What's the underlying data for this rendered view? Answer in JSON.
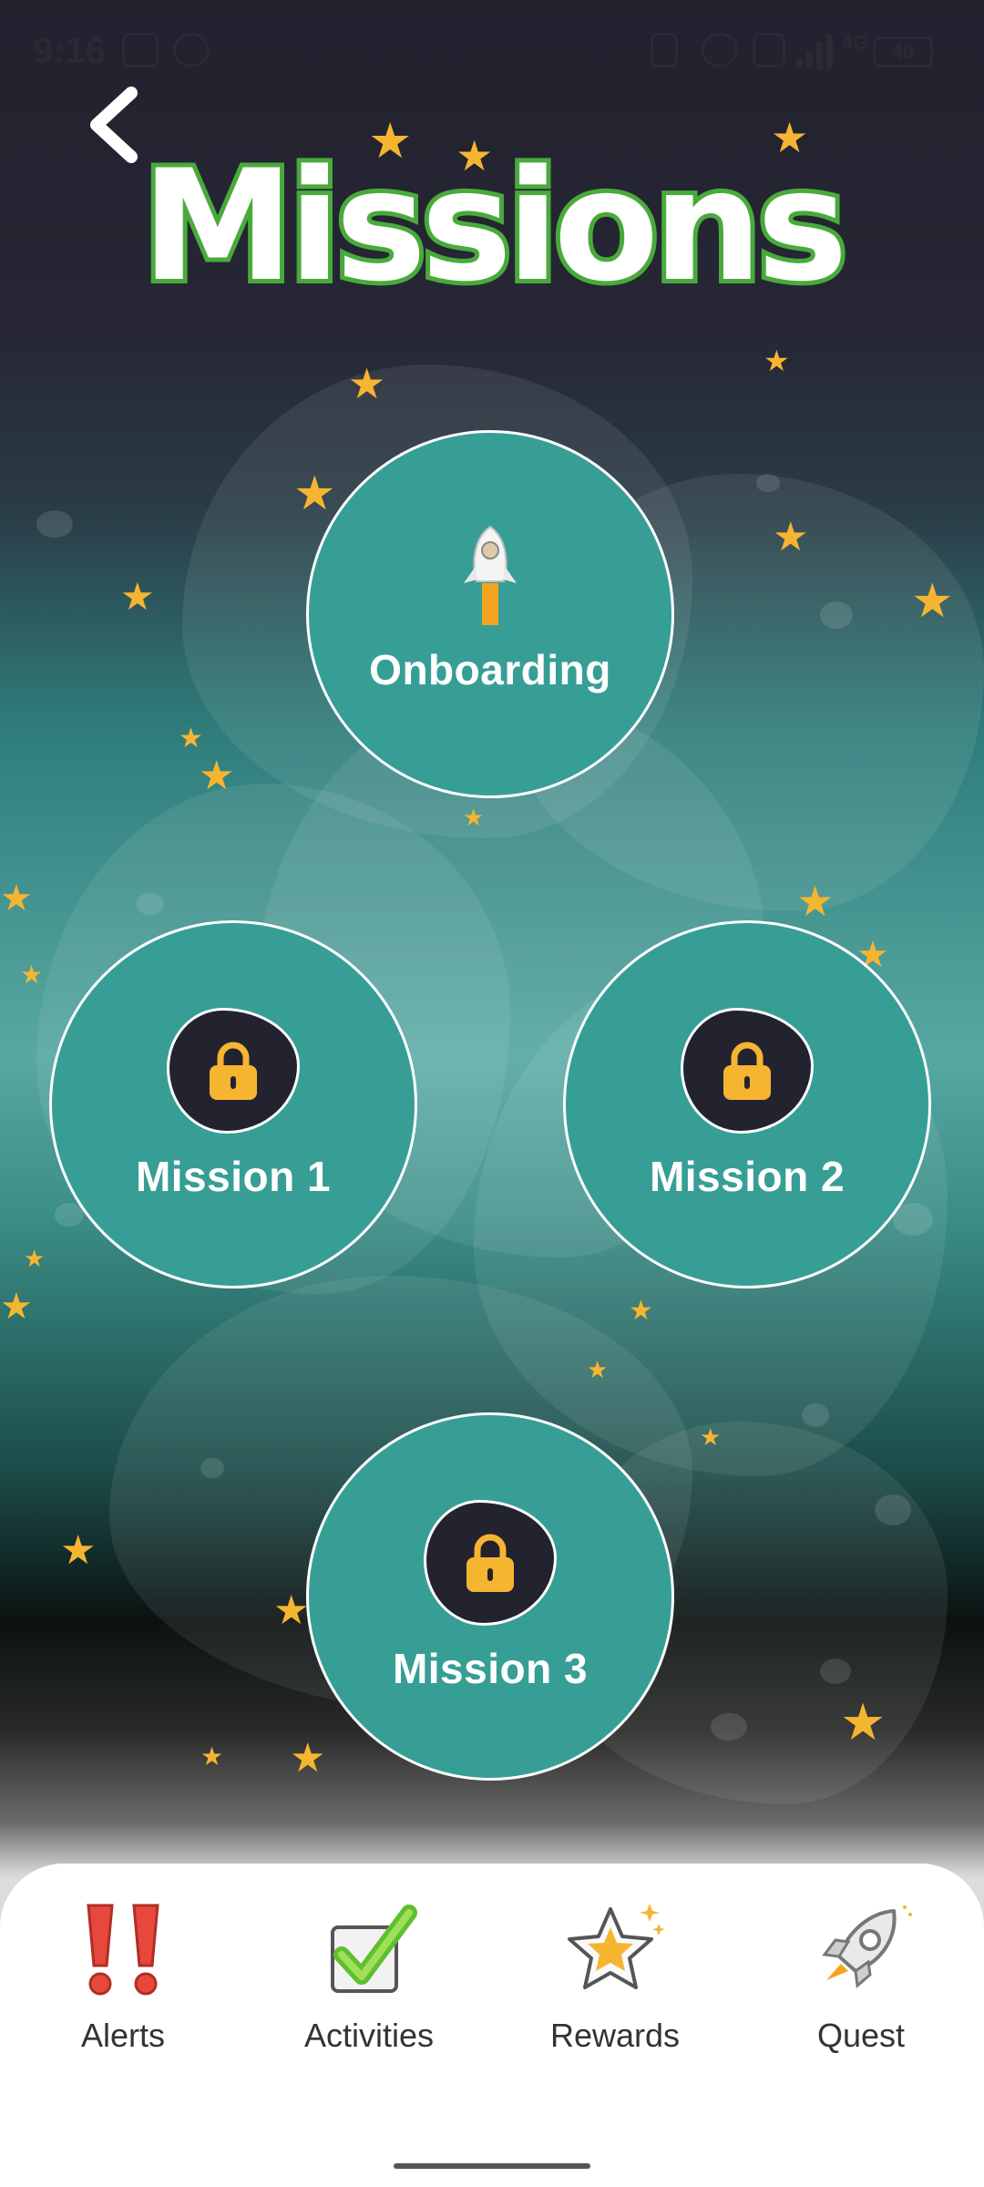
{
  "status_bar": {
    "time": "9:16",
    "network": "4G",
    "battery": "40"
  },
  "header": {
    "title": "Missions",
    "back_icon": "chevron-left-icon"
  },
  "missions": [
    {
      "label": "Onboarding",
      "icon": "rocket-astronaut-icon",
      "locked": false
    },
    {
      "label": "Mission 1",
      "icon": "lock-icon",
      "locked": true
    },
    {
      "label": "Mission 2",
      "icon": "lock-icon",
      "locked": true
    },
    {
      "label": "Mission 3",
      "icon": "lock-icon",
      "locked": true
    }
  ],
  "bottom_nav": {
    "items": [
      {
        "label": "Alerts",
        "icon": "exclamation-icon"
      },
      {
        "label": "Activities",
        "icon": "checkmark-icon"
      },
      {
        "label": "Rewards",
        "icon": "star-icon"
      },
      {
        "label": "Quest",
        "icon": "rocket-icon"
      }
    ]
  },
  "colors": {
    "mission_circle": "#379e96",
    "title_stroke": "#49aa3c",
    "star": "#f6b531",
    "lock": "#f6b531",
    "lock_bg": "#23232f"
  }
}
